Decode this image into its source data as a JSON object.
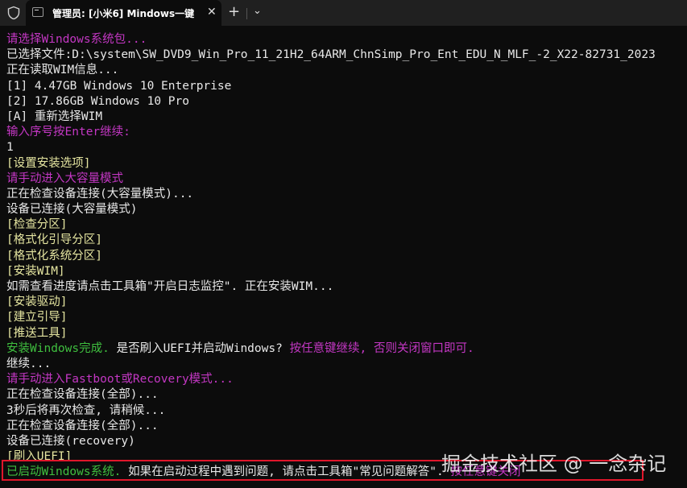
{
  "window": {
    "tab_title": "管理员: [小米6] Mindows一键",
    "close_glyph": "✕",
    "new_tab_glyph": "+",
    "dropdown_glyph": "⌄",
    "icons": [
      "shield-icon",
      "terminal-icon"
    ]
  },
  "terminal": {
    "lines": [
      {
        "text": "请选择Windows系统包...",
        "color": "magenta"
      },
      {
        "text": "已选择文件:D:\\system\\SW_DVD9_Win_Pro_11_21H2_64ARM_ChnSimp_Pro_Ent_EDU_N_MLF_-2_X22-82731_2023",
        "color": "white"
      },
      {
        "text": "正在读取WIM信息...",
        "color": "white"
      },
      {
        "text": "[1] 4.47GB Windows 10 Enterprise",
        "color": "white"
      },
      {
        "text": "[2] 17.86GB Windows 10 Pro",
        "color": "white"
      },
      {
        "text": "[A] 重新选择WIM",
        "color": "white"
      },
      {
        "text": "输入序号按Enter继续:",
        "color": "magenta"
      },
      {
        "text": "                    1",
        "color": "white"
      },
      {
        "text": "[设置安装选项]",
        "color": "yellow"
      },
      {
        "text": "请手动进入大容量模式",
        "color": "magenta"
      },
      {
        "text": "正在检查设备连接(大容量模式)...",
        "color": "white"
      },
      {
        "text": "设备已连接(大容量模式)",
        "color": "white"
      },
      {
        "text": "[检查分区]",
        "color": "yellow"
      },
      {
        "text": "[格式化引导分区]",
        "color": "yellow"
      },
      {
        "text": "[格式化系统分区]",
        "color": "yellow"
      },
      {
        "text": "[安装WIM]",
        "color": "yellow"
      },
      {
        "text": "如需查看进度请点击工具箱\"开启日志监控\". 正在安装WIM...",
        "color": "white"
      },
      {
        "text": "[安装驱动]",
        "color": "yellow"
      },
      {
        "text": "[建立引导]",
        "color": "yellow"
      },
      {
        "text": "[推送工具]",
        "color": "yellow"
      }
    ],
    "install_done_line": {
      "green": "安装Windows完成.",
      "white": " 是否刷入UEFI并启动Windows? ",
      "magenta": "按任意键继续, 否则关闭窗口即可."
    },
    "lines2": [
      {
        "text": "继续...",
        "color": "white"
      },
      {
        "text": "请手动进入Fastboot或Recovery模式...",
        "color": "magenta"
      },
      {
        "text": "正在检查设备连接(全部)...",
        "color": "white"
      },
      {
        "text": "3秒后将再次检查, 请稍候...",
        "color": "white"
      },
      {
        "text": "正在检查设备连接(全部)...",
        "color": "white"
      },
      {
        "text": "设备已连接(recovery)",
        "color": "white"
      },
      {
        "text": "[刷入UEFI]",
        "color": "yellow"
      }
    ],
    "final_line": {
      "green": "已启动Windows系统.",
      "white": " 如果在启动过程中遇到问题, 请点击工具箱\"常见问题解答\". ",
      "magenta": "按任意键关闭"
    }
  },
  "watermark": "掘金技术社区 @ 一念杂记",
  "colors": {
    "magenta": "#c337c3",
    "yellow": "#e5e5a0",
    "green": "#3fbf3f",
    "white": "#e8e8e8",
    "highlight": "#e0162b"
  }
}
